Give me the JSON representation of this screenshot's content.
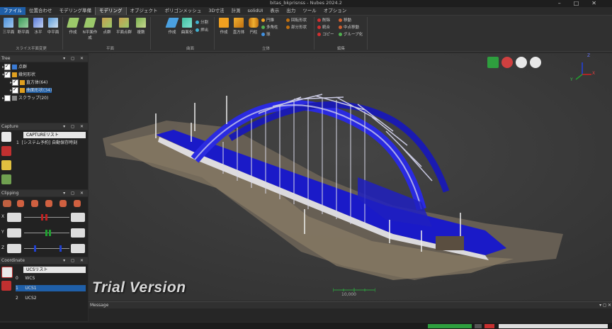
{
  "window": {
    "title": "bitas_bkprisnss - Nubes 2024.2",
    "controls": [
      "–",
      "□",
      "✕"
    ]
  },
  "menu": {
    "items": [
      {
        "label": "ファイル",
        "state": "active"
      },
      {
        "label": "位置合わせ",
        "state": ""
      },
      {
        "label": "モデリング準備",
        "state": ""
      },
      {
        "label": "モデリング",
        "state": "selected"
      },
      {
        "label": "オブジェクト",
        "state": ""
      },
      {
        "label": "ポリゴンメッシュ",
        "state": ""
      },
      {
        "label": "3D寸法",
        "state": ""
      },
      {
        "label": "計測",
        "state": ""
      },
      {
        "label": "solidUI",
        "state": ""
      },
      {
        "label": "表示",
        "state": ""
      },
      {
        "label": "出力",
        "state": ""
      },
      {
        "label": "ツール",
        "state": ""
      },
      {
        "label": "オプション",
        "state": ""
      }
    ]
  },
  "ribbon": {
    "groups": [
      {
        "label": "スライス平面変更",
        "buttons": [
          "三平面",
          "断平面",
          "水平",
          "中平面"
        ]
      },
      {
        "label": "平面",
        "buttons": [
          "作成",
          "N平面作成",
          "点群",
          "平面点群",
          "複数"
        ]
      },
      {
        "label": "曲面",
        "buttons": [
          "作成",
          "曲面化",
          "分割",
          "押出"
        ]
      },
      {
        "label": "立体",
        "buttons": [
          "作成",
          "直方体",
          "円柱"
        ]
      },
      {
        "label": "",
        "small": [
          "円錐",
          "多角柱",
          "球",
          "回転形状",
          "部分形状"
        ]
      },
      {
        "label": "編集",
        "small": [
          "削除",
          "統合",
          "コピー",
          "移動",
          "中点移動",
          "グループ化"
        ]
      }
    ]
  },
  "tree": {
    "title": "Tree",
    "items": [
      {
        "label": "点群",
        "level": 0,
        "checked": true,
        "selected": false,
        "icon_color": "#3a7bd5"
      },
      {
        "label": "幾何形状",
        "level": 0,
        "checked": true,
        "selected": false,
        "icon_color": "#e0a020"
      },
      {
        "label": "直方体(64)",
        "level": 1,
        "checked": true,
        "selected": false,
        "icon_color": "#e0a020"
      },
      {
        "label": "曲面形状(34)",
        "level": 1,
        "checked": true,
        "selected": true,
        "icon_color": "#e0a020"
      },
      {
        "label": "スクラップ(20)",
        "level": 0,
        "checked": false,
        "selected": false,
        "icon_color": "#888888"
      }
    ]
  },
  "capture": {
    "title": "Capture",
    "list_header": "CAPTUREリスト",
    "rows": [
      {
        "index": "1",
        "label": "[システム予約] 自動保存時刻"
      }
    ]
  },
  "clipping": {
    "title": "Clipping",
    "axes": [
      {
        "label": "X",
        "color": "#c02020"
      },
      {
        "label": "Y",
        "color": "#20a030"
      },
      {
        "label": "Z",
        "color": "#2040d0"
      }
    ]
  },
  "coordinate": {
    "title": "Coordinate",
    "list_header": "UCSリスト",
    "rows": [
      {
        "index": "0",
        "label": "WCS",
        "selected": false
      },
      {
        "index": "1",
        "label": "UCS1",
        "selected": true
      },
      {
        "index": "2",
        "label": "UCS2",
        "selected": false
      }
    ]
  },
  "viewport": {
    "watermark": "Trial Version",
    "scale_label": "10,000",
    "axis_labels": {
      "z": "Z",
      "x": "X",
      "y": "Y"
    },
    "view_controls": [
      "fit-icon",
      "globe-icon",
      "dome-icon",
      "pause-icon"
    ]
  },
  "message": {
    "title": "Message"
  },
  "colors": {
    "accent": "#1f5fa8",
    "bridge": "#1a1ac8",
    "status_green": "#2e9e3e",
    "status_red": "#c83030"
  }
}
